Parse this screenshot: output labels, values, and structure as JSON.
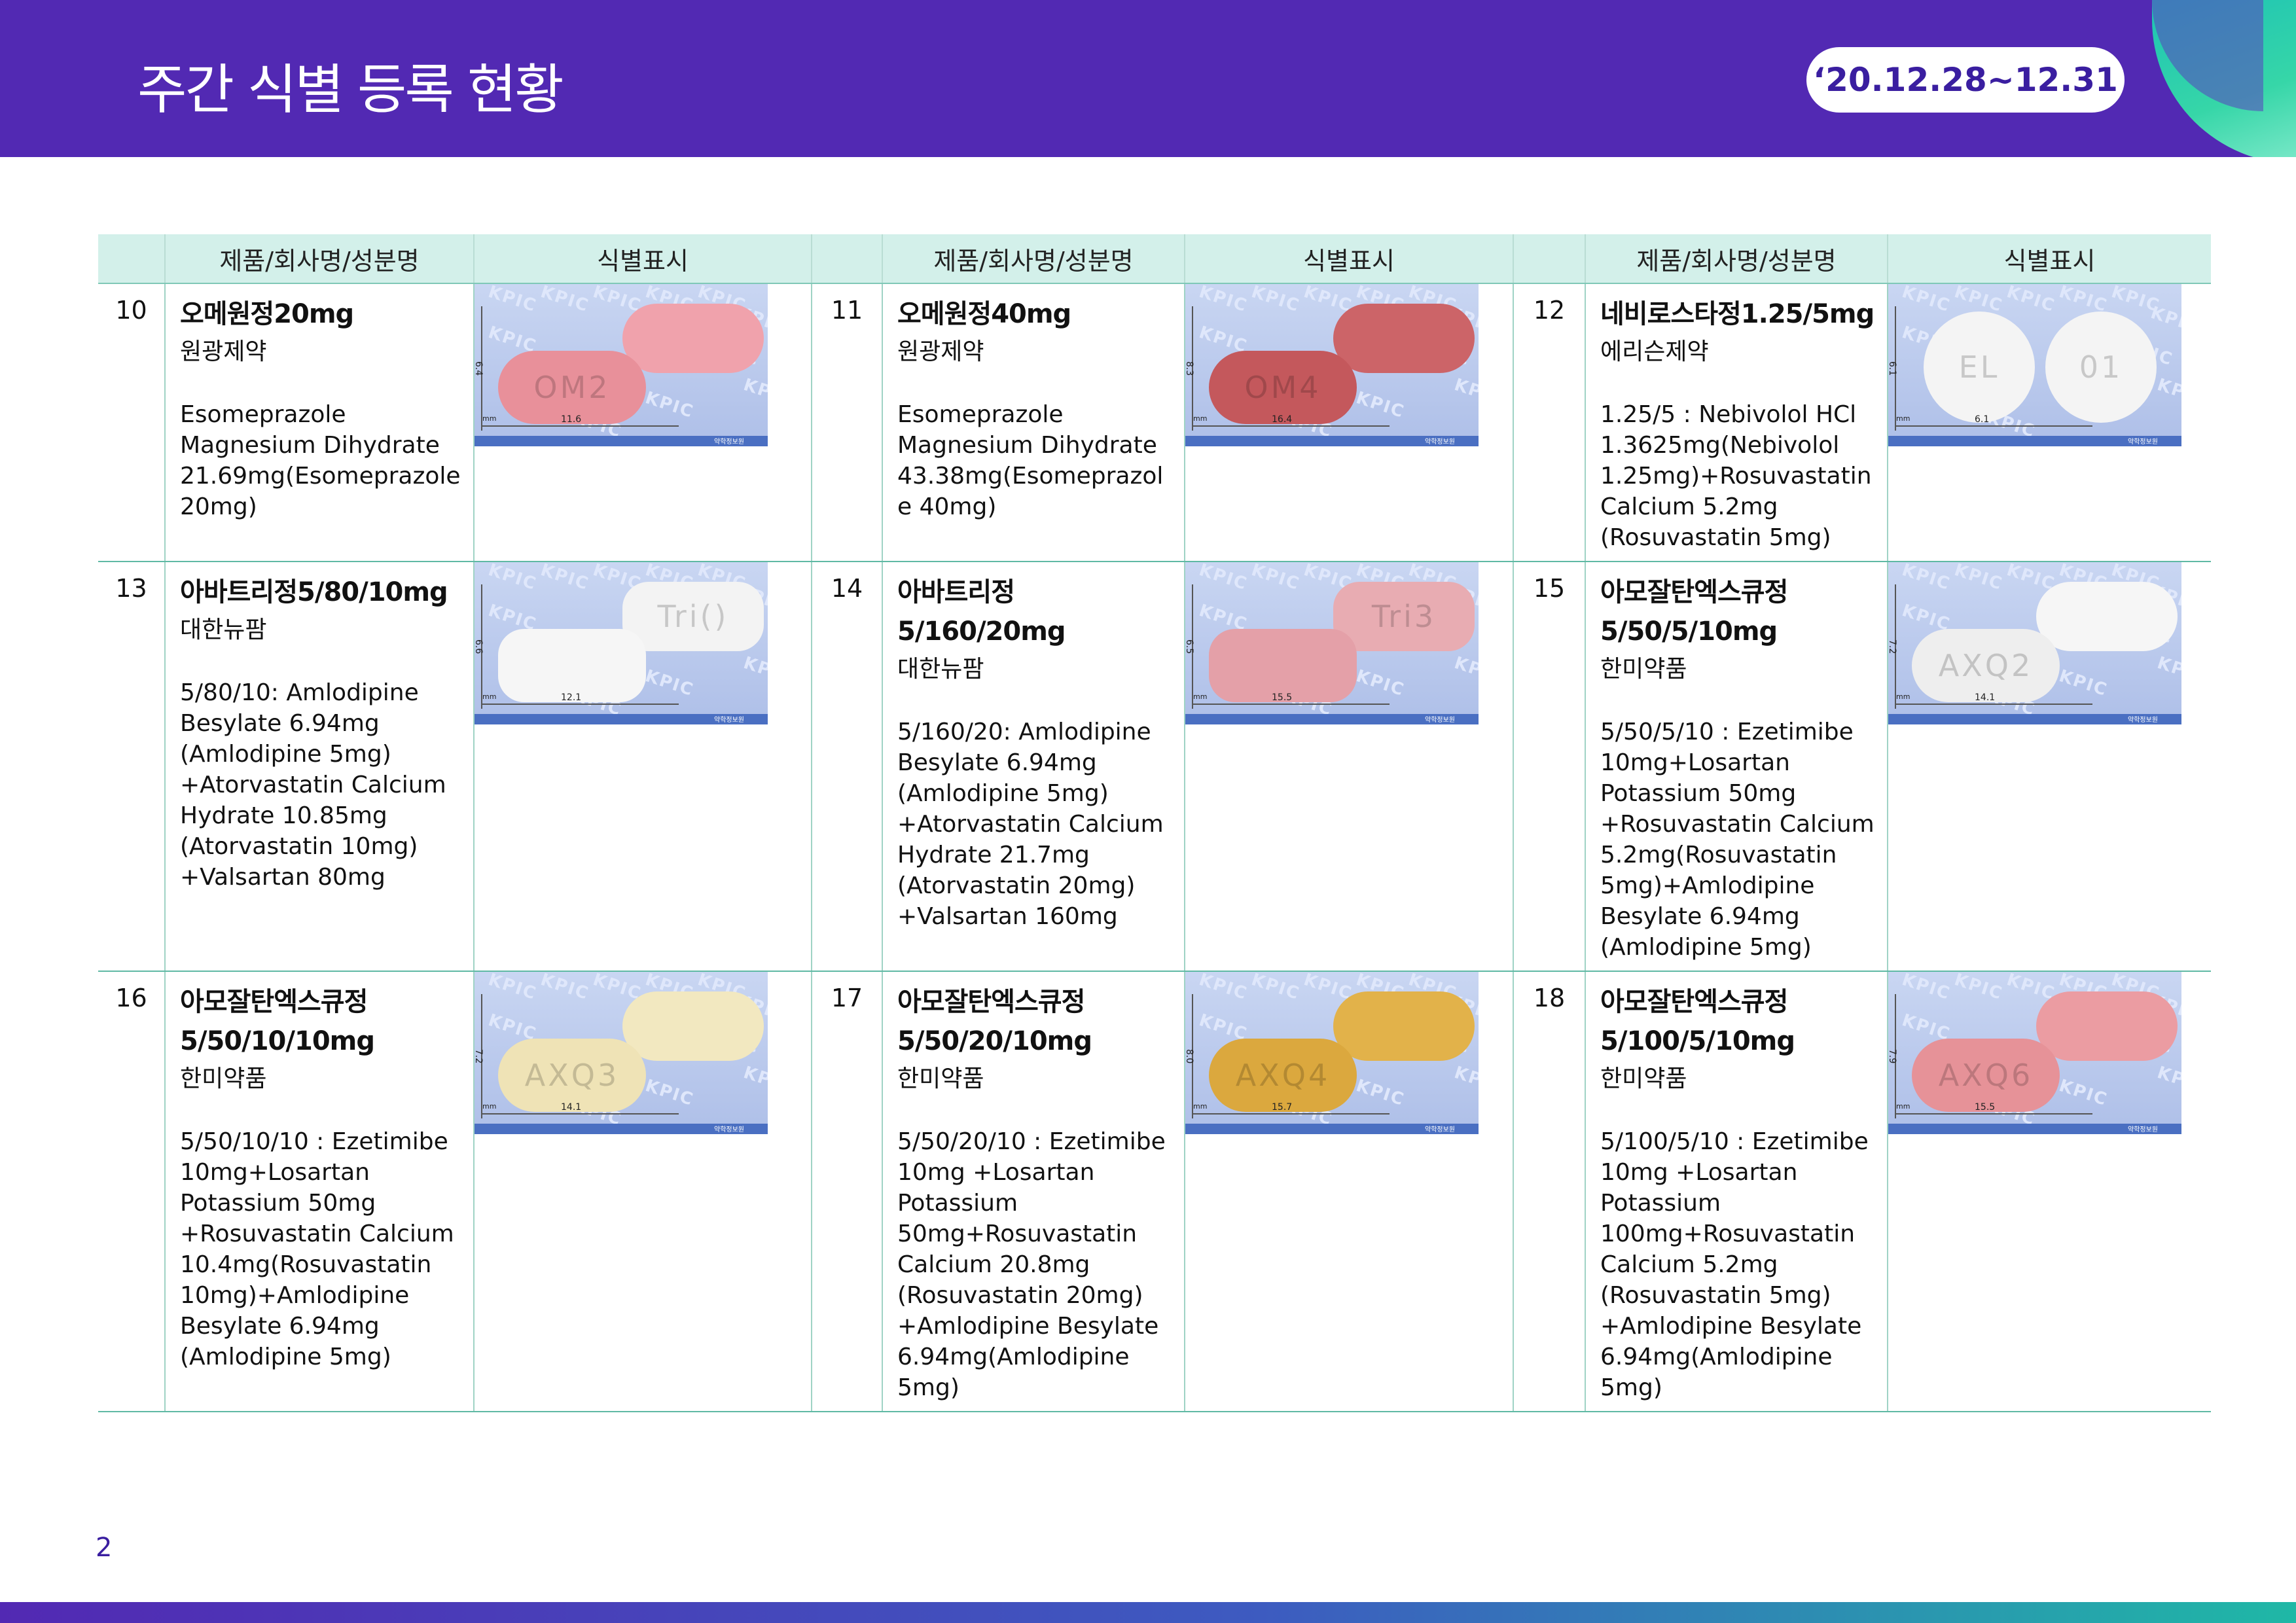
{
  "header": {
    "title": "주간 식별 등록 현황",
    "date_range": "‘20.12.28~12.31"
  },
  "table": {
    "headers": [
      "",
      "제품/회사명/성분명",
      "식별표시",
      "",
      "제품/회사명/성분명",
      "식별표시",
      "",
      "제품/회사명/성분명",
      "식별표시"
    ],
    "watermark": "KPIC",
    "photo_footer": "약학정보원",
    "photo_unit": "mm",
    "rows": [
      [
        {
          "num": "10",
          "name": "오메원정20mg",
          "company": "원광제약",
          "ingredients": "Esomeprazole Magnesium Dihydrate 21.69mg(Esomeprazole 20mg)",
          "pill": {
            "shape": "oval",
            "color_front": "#e8909a",
            "color_back": "#f0a2ac",
            "imprint": "OM2",
            "dim_v": "6.4",
            "dim_h": "11.6"
          }
        },
        {
          "num": "11",
          "name": "오메원정40mg",
          "company": "원광제약",
          "ingredients": "Esomeprazole Magnesium Dihydrate 43.38mg(Esomeprazole 40mg)",
          "pill": {
            "shape": "oval",
            "color_front": "#c4585c",
            "color_back": "#cc6468",
            "imprint": "OM4",
            "dim_v": "8.3",
            "dim_h": "16.4"
          }
        },
        {
          "num": "12",
          "name": "네비로스타정1.25/5mg",
          "company": "에리슨제약",
          "ingredients": "1.25/5 : Nebivolol HCl 1.3625mg(Nebivolol 1.25mg)+Rosuvastatin Calcium 5.2mg (Rosuvastatin 5mg)",
          "pill": {
            "shape": "round",
            "color_front": "#f4f4f4",
            "color_back": "#f4f4f4",
            "imprint": "EL",
            "imprint_back": "01",
            "dim_v": "6.1",
            "dim_h": "6.1"
          }
        }
      ],
      [
        {
          "num": "13",
          "name": "아바트리정5/80/10mg",
          "company": "대한뉴팜",
          "ingredients": "5/80/10: Amlodipine Besylate 6.94mg (Amlodipine 5mg) +Atorvastatin Calcium Hydrate 10.85mg (Atorvastatin 10mg) +Valsartan 80mg",
          "pill": {
            "shape": "oblong",
            "color_front": "#f6f6f6",
            "color_back": "#f3f3f3",
            "imprint": "Tri()",
            "dim_v": "6.6",
            "dim_h": "12.1"
          }
        },
        {
          "num": "14",
          "name": "아바트리정 5/160/20mg",
          "company": "대한뉴팜",
          "ingredients": "5/160/20: Amlodipine Besylate 6.94mg (Amlodipine 5mg) +Atorvastatin Calcium Hydrate 21.7mg (Atorvastatin 20mg) +Valsartan 160mg",
          "pill": {
            "shape": "oblong",
            "color_front": "#e4a0a8",
            "color_back": "#e8acb2",
            "imprint": "Tri3",
            "dim_v": "6.5",
            "dim_h": "15.5"
          }
        },
        {
          "num": "15",
          "name": "아모잘탄엑스큐정 5/50/5/10mg",
          "company": "한미약품",
          "ingredients": "5/50/5/10 : Ezetimibe 10mg+Losartan Potassium 50mg +Rosuvastatin Calcium 5.2mg(Rosuvastatin 5mg)+Amlodipine Besylate 6.94mg (Amlodipine 5mg)",
          "pill": {
            "shape": "oval",
            "color_front": "#eeeeee",
            "color_back": "#f6f6f6",
            "imprint": "AXQ2",
            "dim_v": "7.2",
            "dim_h": "14.1"
          }
        }
      ],
      [
        {
          "num": "16",
          "name": "아모잘탄엑스큐정 5/50/10/10mg",
          "company": "한미약품",
          "ingredients": "5/50/10/10 : Ezetimibe 10mg+Losartan Potassium 50mg +Rosuvastatin Calcium 10.4mg(Rosuvastatin 10mg)+Amlodipine Besylate 6.94mg (Amlodipine 5mg)",
          "pill": {
            "shape": "oval",
            "color_front": "#efe3b6",
            "color_back": "#f2e8c0",
            "imprint": "AXQ3",
            "dim_v": "7.2",
            "dim_h": "14.1"
          }
        },
        {
          "num": "17",
          "name": "아모잘탄엑스큐정 5/50/20/10mg",
          "company": "한미약품",
          "ingredients": "5/50/20/10 : Ezetimibe 10mg +Losartan Potassium 50mg+Rosuvastatin Calcium 20.8mg (Rosuvastatin 20mg) +Amlodipine Besylate 6.94mg(Amlodipine 5mg)",
          "pill": {
            "shape": "oval",
            "color_front": "#dba83e",
            "color_back": "#e2b24a",
            "imprint": "AXQ4",
            "dim_v": "8.0",
            "dim_h": "15.7"
          }
        },
        {
          "num": "18",
          "name": "아모잘탄엑스큐정 5/100/5/10mg",
          "company": "한미약품",
          "ingredients": "5/100/5/10 : Ezetimibe 10mg +Losartan Potassium 100mg+Rosuvastatin Calcium 5.2mg (Rosuvastatin 5mg) +Amlodipine Besylate 6.94mg(Amlodipine 5mg)",
          "pill": {
            "shape": "oval",
            "color_front": "#e69298",
            "color_back": "#eb9ca2",
            "imprint": "AXQ6",
            "dim_v": "7.9",
            "dim_h": "15.5"
          }
        }
      ]
    ]
  },
  "page_number": "2",
  "colors": {
    "header": "#5229b3",
    "table_header": "#d3f0ea",
    "accent_teal": "#1fb8a6"
  }
}
